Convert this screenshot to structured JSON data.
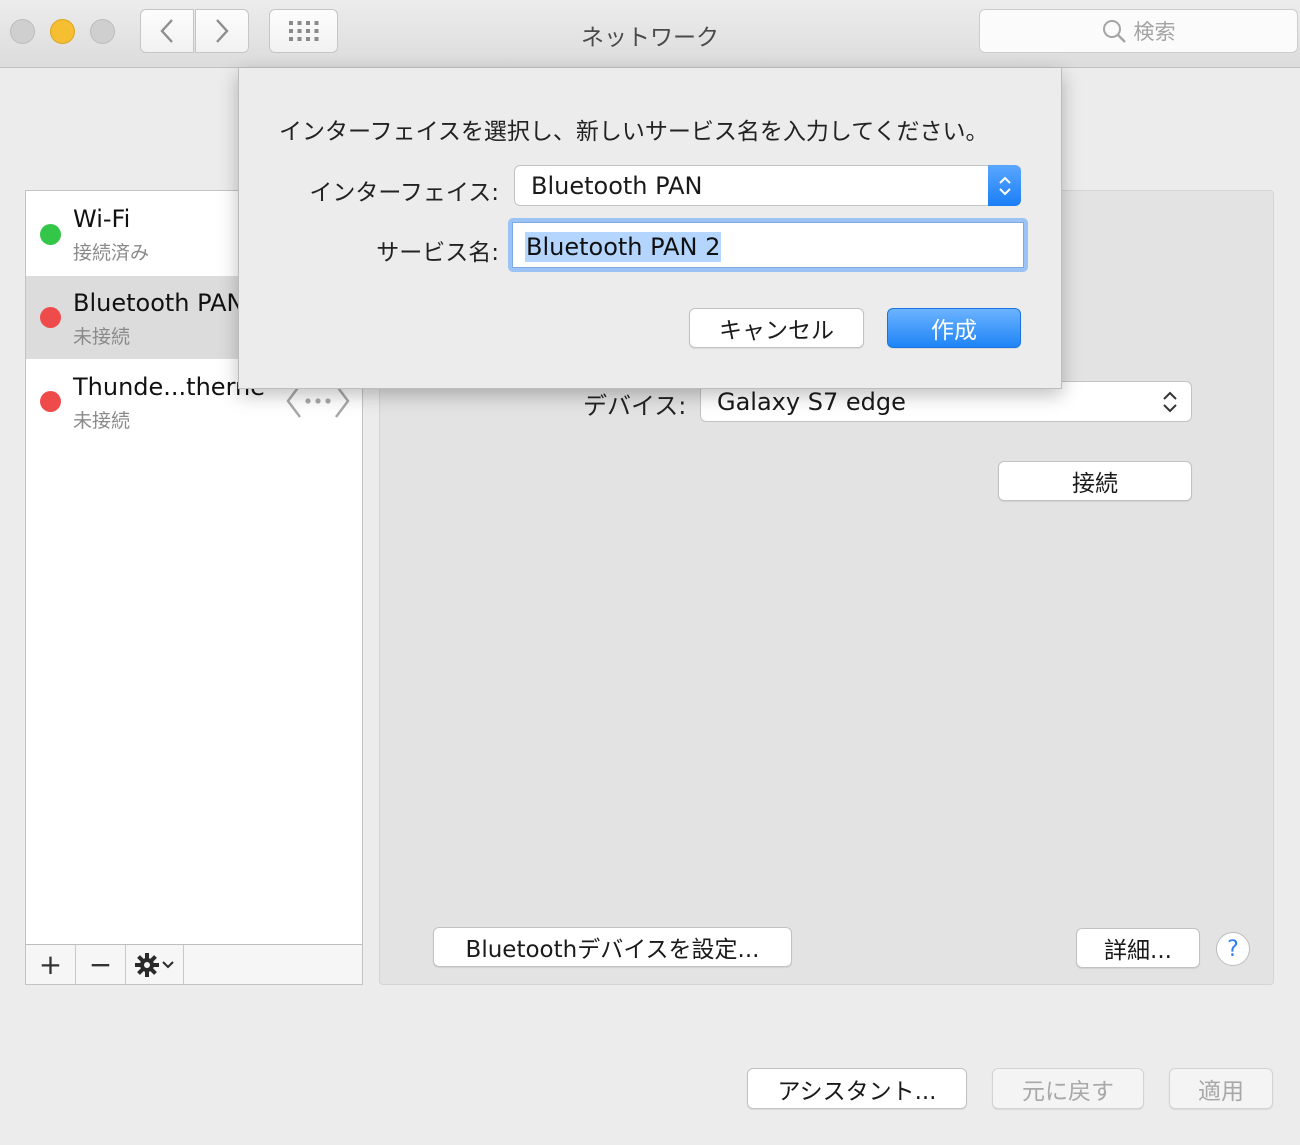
{
  "window": {
    "title": "ネットワーク",
    "search_placeholder": "検索"
  },
  "services": [
    {
      "name": "Wi-Fi",
      "status": "接続済み",
      "status_color": "#33c648"
    },
    {
      "name": "Bluetooth PAN",
      "status": "未接続",
      "status_color": "#ef4b4b"
    },
    {
      "name": "Thunde...therne",
      "status": "未接続",
      "status_color": "#ef4b4b",
      "icon": "ethernet-arrows-icon"
    }
  ],
  "sidebar_toolbar": {
    "add": "+",
    "remove": "−",
    "gear_icon": "gear-icon"
  },
  "main": {
    "device_label": "デバイス:",
    "device_value": "Galaxy S7 edge",
    "connect_button": "接続",
    "bt_setup_button": "Bluetoothデバイスを設定...",
    "details_button": "詳細...",
    "help_button": "?"
  },
  "bottom": {
    "assistant_button": "アシスタント...",
    "revert_button": "元に戻す",
    "apply_button": "適用"
  },
  "sheet": {
    "prompt": "インターフェイスを選択し、新しいサービス名を入力してください。",
    "interface_label": "インターフェイス:",
    "interface_value": "Bluetooth PAN",
    "service_name_label": "サービス名:",
    "service_name_value": "Bluetooth PAN 2",
    "cancel_button": "キャンセル",
    "create_button": "作成"
  },
  "colors": {
    "accent": "#1e84f6",
    "selection": "#b4d5fe"
  }
}
